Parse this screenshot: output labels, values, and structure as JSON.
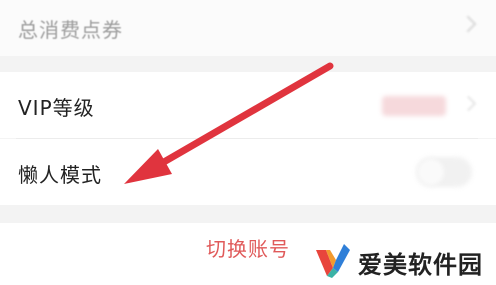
{
  "settings": {
    "total_points_label": "总消费点券",
    "vip_level_label": "VIP等级",
    "lazy_mode_label": "懒人模式",
    "switch_account_label": "切换账号"
  },
  "watermark": {
    "text": "爱美软件园"
  },
  "colors": {
    "annotation_arrow": "#e0343e",
    "switch_account_text": "#e05a5a",
    "logo_red": "#e8453c",
    "logo_orange": "#f29a2e",
    "logo_blue": "#2f7fd8",
    "logo_teal": "#3bb2a6"
  },
  "icons": {
    "row_chevron": "chevron-right-icon",
    "annotation": "red-arrow-icon",
    "watermark_logo": "aimei-logo-icon"
  }
}
